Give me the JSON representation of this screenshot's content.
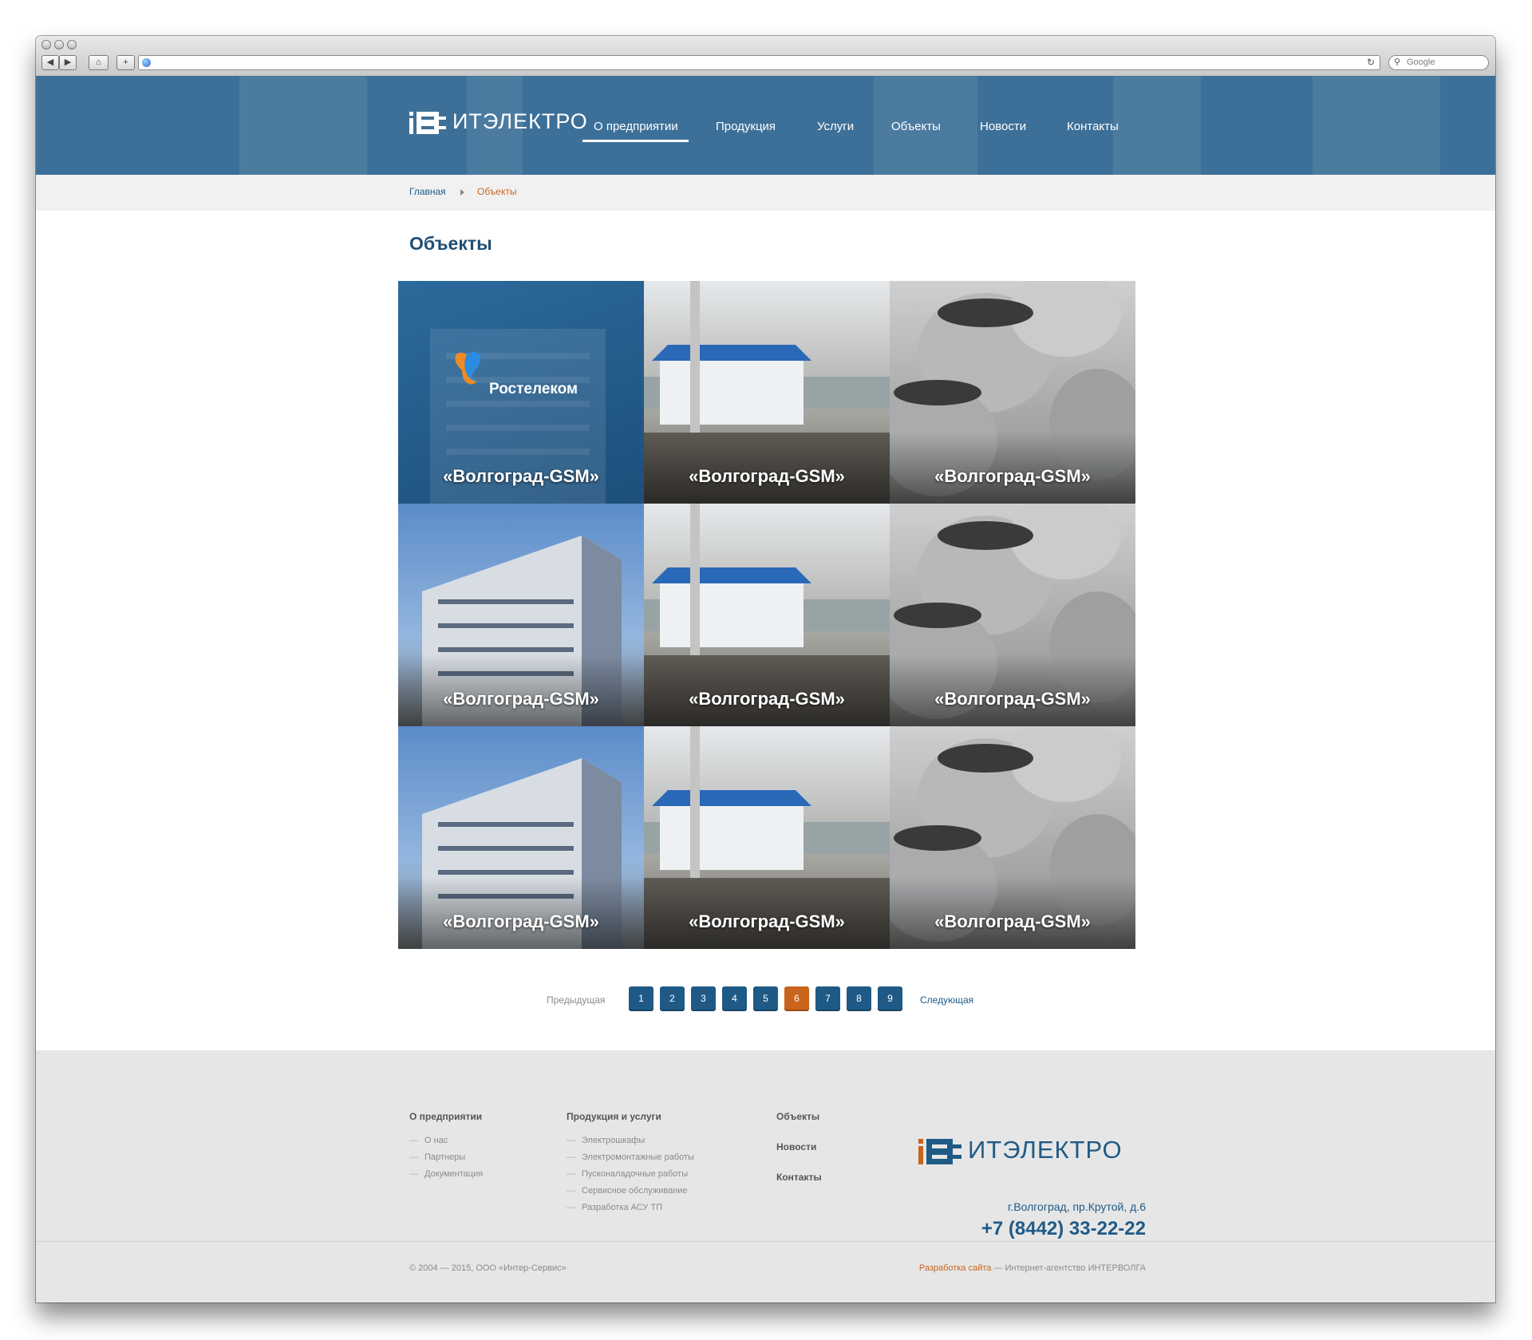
{
  "browser": {
    "search_placeholder": "Google"
  },
  "colors": {
    "header_blue": "#3d7098",
    "brand_blue": "#1f5a86",
    "accent_orange": "#c9641c"
  },
  "header": {
    "logo_text": "ИТЭЛЕКТРО",
    "nav": [
      {
        "label": "О предприятии",
        "active": true
      },
      {
        "label": "Продукция"
      },
      {
        "label": "Услуги"
      },
      {
        "label": "Объекты"
      },
      {
        "label": "Новости"
      },
      {
        "label": "Контакты"
      }
    ]
  },
  "breadcrumb": {
    "home": "Главная",
    "current": "Объекты"
  },
  "main": {
    "title": "Объекты",
    "tiles": [
      {
        "caption": "«Волгоград-GSM»",
        "logo_text": "Ростелеком"
      },
      {
        "caption": "«Волгоград-GSM»"
      },
      {
        "caption": "«Волгоград-GSM»"
      },
      {
        "caption": "«Волгоград-GSM»"
      },
      {
        "caption": "«Волгоград-GSM»"
      },
      {
        "caption": "«Волгоград-GSM»"
      },
      {
        "caption": "«Волгоград-GSM»"
      },
      {
        "caption": "«Волгоград-GSM»"
      },
      {
        "caption": "«Волгоград-GSM»"
      }
    ]
  },
  "pagination": {
    "prev": "Предыдущая",
    "next": "Следующая",
    "pages": [
      "1",
      "2",
      "3",
      "4",
      "5",
      "6",
      "7",
      "8",
      "9"
    ],
    "current": "6"
  },
  "footer": {
    "col1": {
      "heading": "О предприятии",
      "items": [
        "О нас",
        "Партнеры",
        "Документация"
      ]
    },
    "col2": {
      "heading": "Продукция и услуги",
      "items": [
        "Электрошкафы",
        "Электромонтажные работы",
        "Пусконаладочные работы",
        "Сервисное обслуживание",
        "Разработка АСУ ТП"
      ]
    },
    "col3": {
      "items": [
        "Объекты",
        "Новости",
        "Контакты"
      ]
    },
    "logo_text": "ИТЭЛЕКТРО",
    "address": "г.Волгоград, пр.Крутой, д.6",
    "phone": "+7 (8442) 33-22-22",
    "copyright": "© 2004 — 2015, ООО «Интер-Сервис»",
    "dev_link": "Разработка сайта",
    "dev_text": " — Интернет-агентство ИНТЕРВОЛГА"
  }
}
